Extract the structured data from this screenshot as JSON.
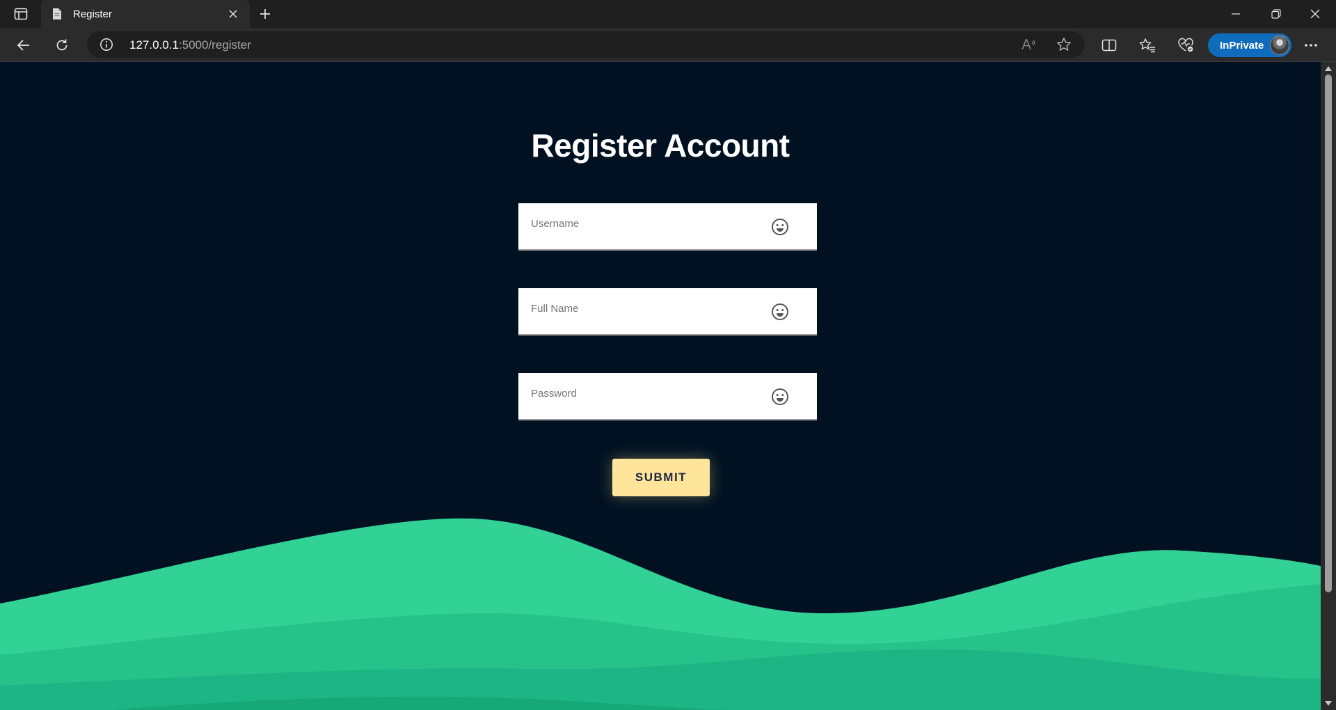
{
  "browser": {
    "tab": {
      "title": "Register",
      "favicon": "page-icon"
    },
    "url": {
      "host": "127.0.0.1",
      "rest": ":5000/register"
    },
    "profile_label": "InPrivate"
  },
  "page": {
    "title": "Register Account",
    "fields": [
      {
        "label": "Username",
        "value": "",
        "icon": "smiley-face-icon"
      },
      {
        "label": "Full Name",
        "value": "",
        "icon": "smiley-face-icon"
      },
      {
        "label": "Password",
        "value": "",
        "icon": "smiley-face-icon"
      }
    ],
    "submit_label": "SUBMIT"
  },
  "colors": {
    "background": "#011121",
    "wave_light": "#32d296",
    "wave_mid": "#26c28a",
    "wave_dark": "#1db584",
    "button": "#ffe49c",
    "button_text": "#1b2342",
    "inprivate": "#0f6cbd"
  }
}
